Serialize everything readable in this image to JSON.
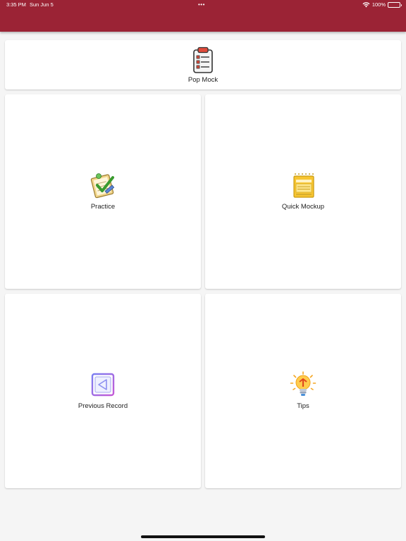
{
  "status_bar": {
    "time": "3:35 PM",
    "date": "Sun Jun 5",
    "dots": "•••",
    "battery_text": "100%",
    "battery_level": 1.0
  },
  "colors": {
    "app_bar": "#9b2335",
    "background": "#f5f5f5",
    "card": "#ffffff"
  },
  "menu": {
    "pop_mock": {
      "label": "Pop Mock",
      "icon": "clipboard-checklist-icon"
    },
    "practice": {
      "label": "Practice",
      "icon": "checklist-pencil-icon"
    },
    "quick_mockup": {
      "label": "Quick Mockup",
      "icon": "yellow-notebook-icon"
    },
    "previous_record": {
      "label": "Previous Record",
      "icon": "back-arrow-square-icon"
    },
    "tips": {
      "label": "Tips",
      "icon": "lightbulb-icon"
    }
  }
}
